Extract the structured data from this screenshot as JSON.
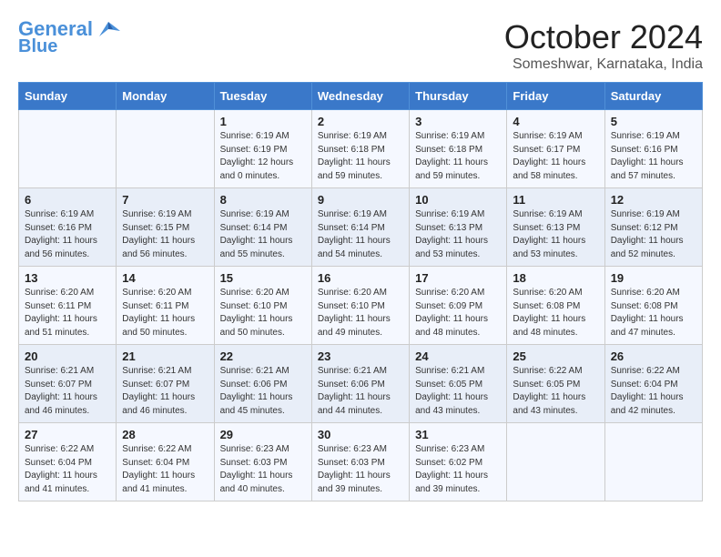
{
  "header": {
    "logo_line1": "General",
    "logo_line2": "Blue",
    "month_title": "October 2024",
    "subtitle": "Someshwar, Karnataka, India"
  },
  "weekdays": [
    "Sunday",
    "Monday",
    "Tuesday",
    "Wednesday",
    "Thursday",
    "Friday",
    "Saturday"
  ],
  "weeks": [
    [
      {
        "day": "",
        "info": ""
      },
      {
        "day": "",
        "info": ""
      },
      {
        "day": "1",
        "info": "Sunrise: 6:19 AM\nSunset: 6:19 PM\nDaylight: 12 hours\nand 0 minutes."
      },
      {
        "day": "2",
        "info": "Sunrise: 6:19 AM\nSunset: 6:18 PM\nDaylight: 11 hours\nand 59 minutes."
      },
      {
        "day": "3",
        "info": "Sunrise: 6:19 AM\nSunset: 6:18 PM\nDaylight: 11 hours\nand 59 minutes."
      },
      {
        "day": "4",
        "info": "Sunrise: 6:19 AM\nSunset: 6:17 PM\nDaylight: 11 hours\nand 58 minutes."
      },
      {
        "day": "5",
        "info": "Sunrise: 6:19 AM\nSunset: 6:16 PM\nDaylight: 11 hours\nand 57 minutes."
      }
    ],
    [
      {
        "day": "6",
        "info": "Sunrise: 6:19 AM\nSunset: 6:16 PM\nDaylight: 11 hours\nand 56 minutes."
      },
      {
        "day": "7",
        "info": "Sunrise: 6:19 AM\nSunset: 6:15 PM\nDaylight: 11 hours\nand 56 minutes."
      },
      {
        "day": "8",
        "info": "Sunrise: 6:19 AM\nSunset: 6:14 PM\nDaylight: 11 hours\nand 55 minutes."
      },
      {
        "day": "9",
        "info": "Sunrise: 6:19 AM\nSunset: 6:14 PM\nDaylight: 11 hours\nand 54 minutes."
      },
      {
        "day": "10",
        "info": "Sunrise: 6:19 AM\nSunset: 6:13 PM\nDaylight: 11 hours\nand 53 minutes."
      },
      {
        "day": "11",
        "info": "Sunrise: 6:19 AM\nSunset: 6:13 PM\nDaylight: 11 hours\nand 53 minutes."
      },
      {
        "day": "12",
        "info": "Sunrise: 6:19 AM\nSunset: 6:12 PM\nDaylight: 11 hours\nand 52 minutes."
      }
    ],
    [
      {
        "day": "13",
        "info": "Sunrise: 6:20 AM\nSunset: 6:11 PM\nDaylight: 11 hours\nand 51 minutes."
      },
      {
        "day": "14",
        "info": "Sunrise: 6:20 AM\nSunset: 6:11 PM\nDaylight: 11 hours\nand 50 minutes."
      },
      {
        "day": "15",
        "info": "Sunrise: 6:20 AM\nSunset: 6:10 PM\nDaylight: 11 hours\nand 50 minutes."
      },
      {
        "day": "16",
        "info": "Sunrise: 6:20 AM\nSunset: 6:10 PM\nDaylight: 11 hours\nand 49 minutes."
      },
      {
        "day": "17",
        "info": "Sunrise: 6:20 AM\nSunset: 6:09 PM\nDaylight: 11 hours\nand 48 minutes."
      },
      {
        "day": "18",
        "info": "Sunrise: 6:20 AM\nSunset: 6:08 PM\nDaylight: 11 hours\nand 48 minutes."
      },
      {
        "day": "19",
        "info": "Sunrise: 6:20 AM\nSunset: 6:08 PM\nDaylight: 11 hours\nand 47 minutes."
      }
    ],
    [
      {
        "day": "20",
        "info": "Sunrise: 6:21 AM\nSunset: 6:07 PM\nDaylight: 11 hours\nand 46 minutes."
      },
      {
        "day": "21",
        "info": "Sunrise: 6:21 AM\nSunset: 6:07 PM\nDaylight: 11 hours\nand 46 minutes."
      },
      {
        "day": "22",
        "info": "Sunrise: 6:21 AM\nSunset: 6:06 PM\nDaylight: 11 hours\nand 45 minutes."
      },
      {
        "day": "23",
        "info": "Sunrise: 6:21 AM\nSunset: 6:06 PM\nDaylight: 11 hours\nand 44 minutes."
      },
      {
        "day": "24",
        "info": "Sunrise: 6:21 AM\nSunset: 6:05 PM\nDaylight: 11 hours\nand 43 minutes."
      },
      {
        "day": "25",
        "info": "Sunrise: 6:22 AM\nSunset: 6:05 PM\nDaylight: 11 hours\nand 43 minutes."
      },
      {
        "day": "26",
        "info": "Sunrise: 6:22 AM\nSunset: 6:04 PM\nDaylight: 11 hours\nand 42 minutes."
      }
    ],
    [
      {
        "day": "27",
        "info": "Sunrise: 6:22 AM\nSunset: 6:04 PM\nDaylight: 11 hours\nand 41 minutes."
      },
      {
        "day": "28",
        "info": "Sunrise: 6:22 AM\nSunset: 6:04 PM\nDaylight: 11 hours\nand 41 minutes."
      },
      {
        "day": "29",
        "info": "Sunrise: 6:23 AM\nSunset: 6:03 PM\nDaylight: 11 hours\nand 40 minutes."
      },
      {
        "day": "30",
        "info": "Sunrise: 6:23 AM\nSunset: 6:03 PM\nDaylight: 11 hours\nand 39 minutes."
      },
      {
        "day": "31",
        "info": "Sunrise: 6:23 AM\nSunset: 6:02 PM\nDaylight: 11 hours\nand 39 minutes."
      },
      {
        "day": "",
        "info": ""
      },
      {
        "day": "",
        "info": ""
      }
    ]
  ]
}
